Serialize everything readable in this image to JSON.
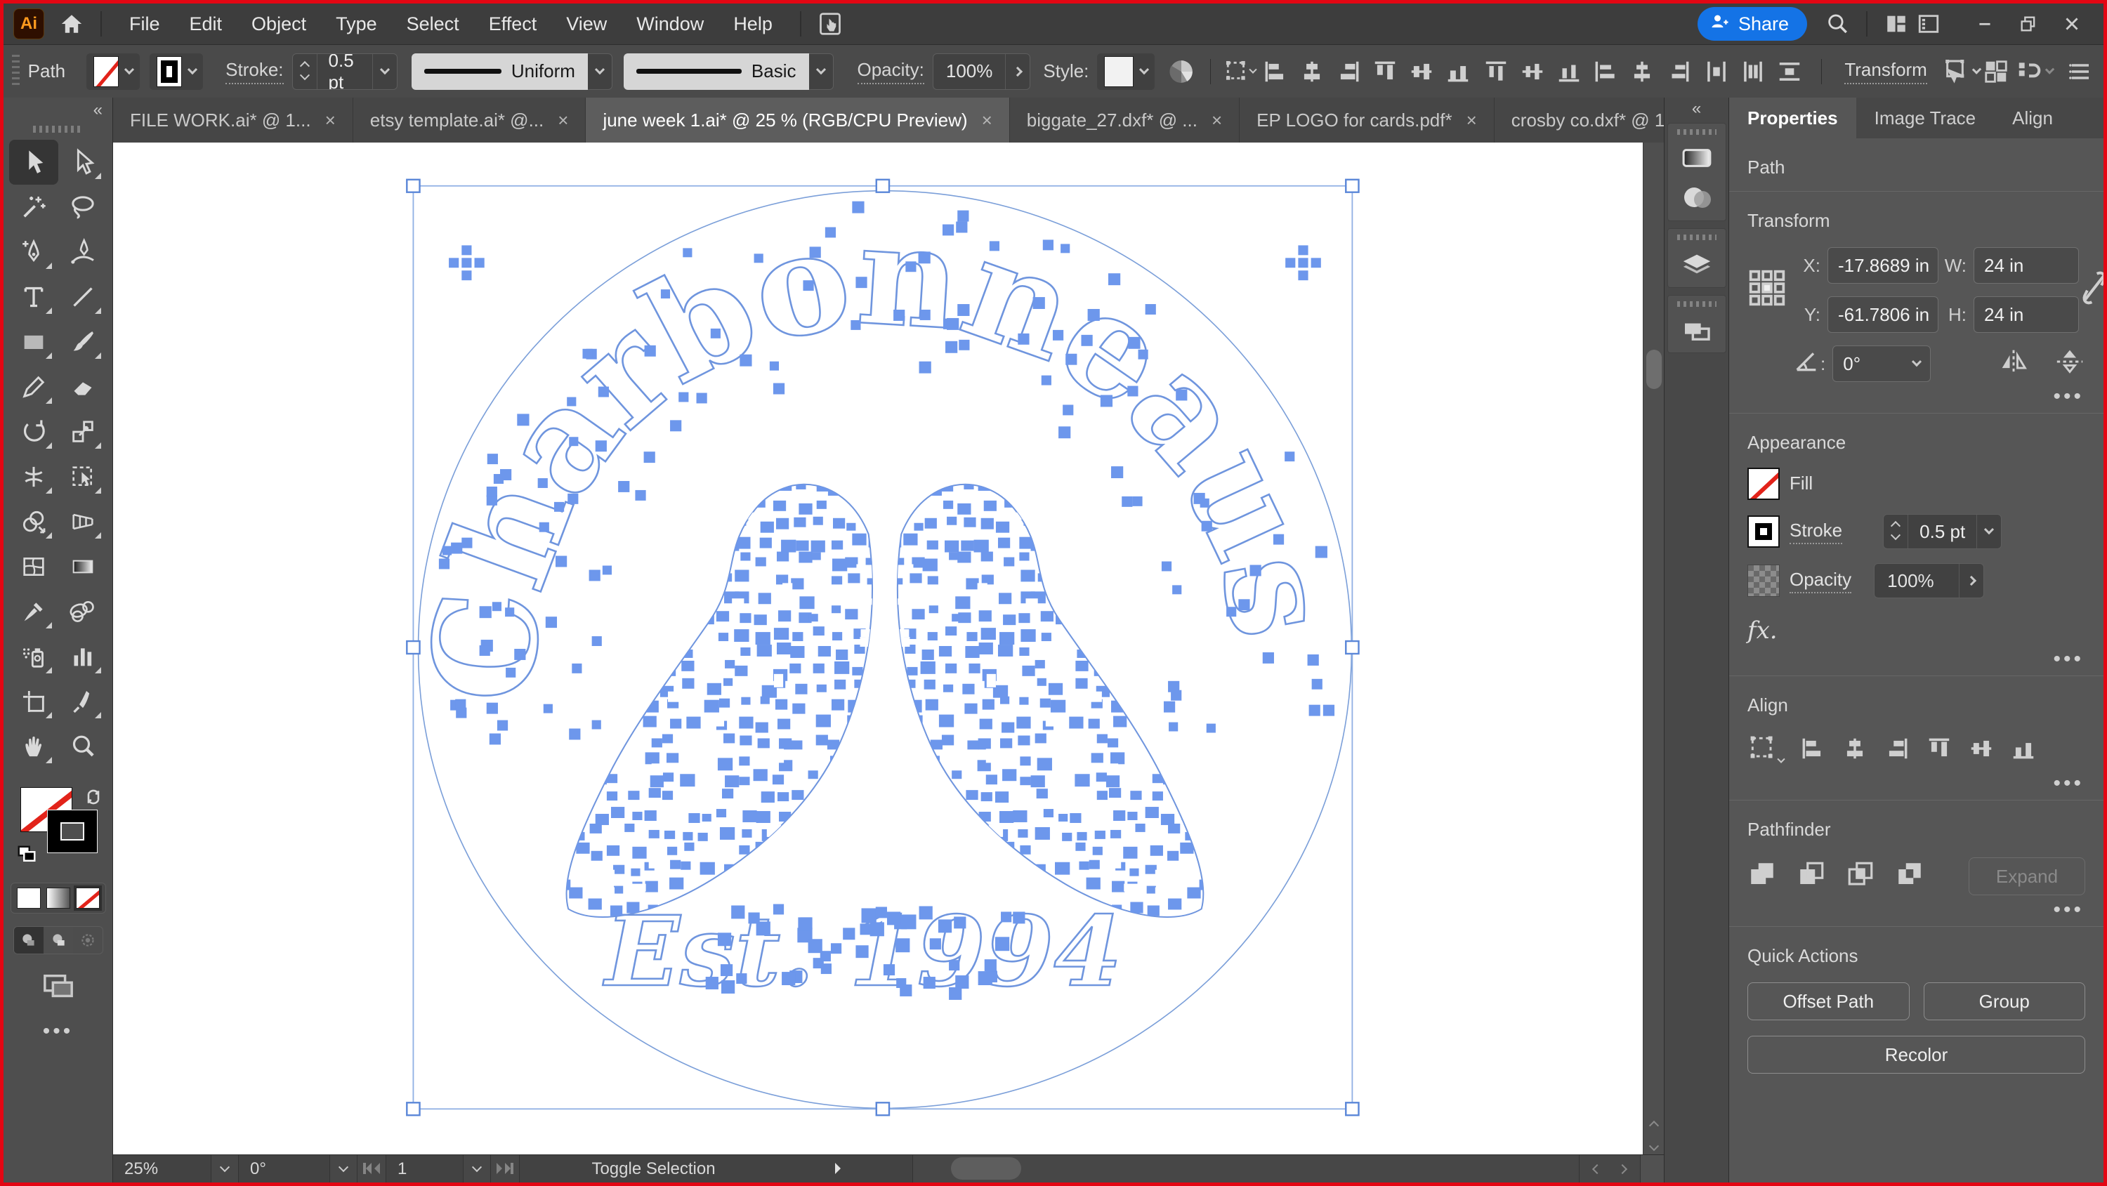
{
  "menu_bar": {
    "app_logo": "Ai",
    "items": [
      "File",
      "Edit",
      "Object",
      "Type",
      "Select",
      "Effect",
      "View",
      "Window",
      "Help"
    ],
    "share_label": "Share"
  },
  "control_bar": {
    "context_label": "Path",
    "stroke_label": "Stroke:",
    "stroke_value": "0.5 pt",
    "profile_value": "Uniform",
    "brush_value": "Basic",
    "opacity_label": "Opacity:",
    "opacity_value": "100%",
    "style_label": "Style:",
    "transform_label": "Transform"
  },
  "tabs": [
    {
      "label": "FILE WORK.ai* @ 1...",
      "active": false
    },
    {
      "label": "etsy template.ai* @...",
      "active": false
    },
    {
      "label": "june week 1.ai* @ 25 % (RGB/CPU Preview)",
      "active": true
    },
    {
      "label": "biggate_27.dxf* @ ...",
      "active": false
    },
    {
      "label": "EP LOGO for cards.pdf*",
      "active": false
    },
    {
      "label": "crosby co.dxf* @ 1...",
      "active": false
    }
  ],
  "tab_overflow": "»",
  "toolbar": {
    "tools": [
      "selection",
      "direct-selection",
      "magic-wand",
      "lasso",
      "pen",
      "curvature",
      "type",
      "line",
      "rectangle",
      "paintbrush",
      "pencil",
      "eraser",
      "rotate",
      "scale",
      "width",
      "free-transform",
      "shape-builder",
      "perspective-grid",
      "mesh",
      "gradient",
      "eyedropper",
      "blend",
      "symbol-sprayer",
      "column-graph",
      "artboard",
      "slice",
      "hand",
      "zoom"
    ],
    "active_tool": "selection"
  },
  "artwork": {
    "arc_text": "Charbonneaus",
    "bottom_text": "Est. 1994",
    "selection_color": "#6d97ec",
    "outline_color": "#6f95de",
    "handle_stroke": "#5b87d8"
  },
  "dock_panels": [
    "gradient",
    "transparency",
    "layers",
    "artboards"
  ],
  "properties": {
    "tabs": [
      "Properties",
      "Image Trace",
      "Align"
    ],
    "active_tab": "Properties",
    "object_type": "Path",
    "transform": {
      "title": "Transform",
      "x_label": "X:",
      "x_value": "-17.8689 in",
      "y_label": "Y:",
      "y_value": "-61.7806 in",
      "w_label": "W:",
      "w_value": "24 in",
      "h_label": "H:",
      "h_value": "24 in",
      "angle_value": "0°"
    },
    "appearance": {
      "title": "Appearance",
      "fill_label": "Fill",
      "stroke_label": "Stroke",
      "stroke_value": "0.5 pt",
      "opacity_label": "Opacity",
      "opacity_value": "100%",
      "fx_label": "fx."
    },
    "align": {
      "title": "Align"
    },
    "pathfinder": {
      "title": "Pathfinder",
      "expand_label": "Expand"
    },
    "quick_actions": {
      "title": "Quick Actions",
      "buttons": [
        "Offset Path",
        "Group",
        "Recolor"
      ]
    }
  },
  "status_bar": {
    "zoom": "25%",
    "rotation": "0°",
    "artboard": "1",
    "selection_label": "Toggle Selection"
  }
}
